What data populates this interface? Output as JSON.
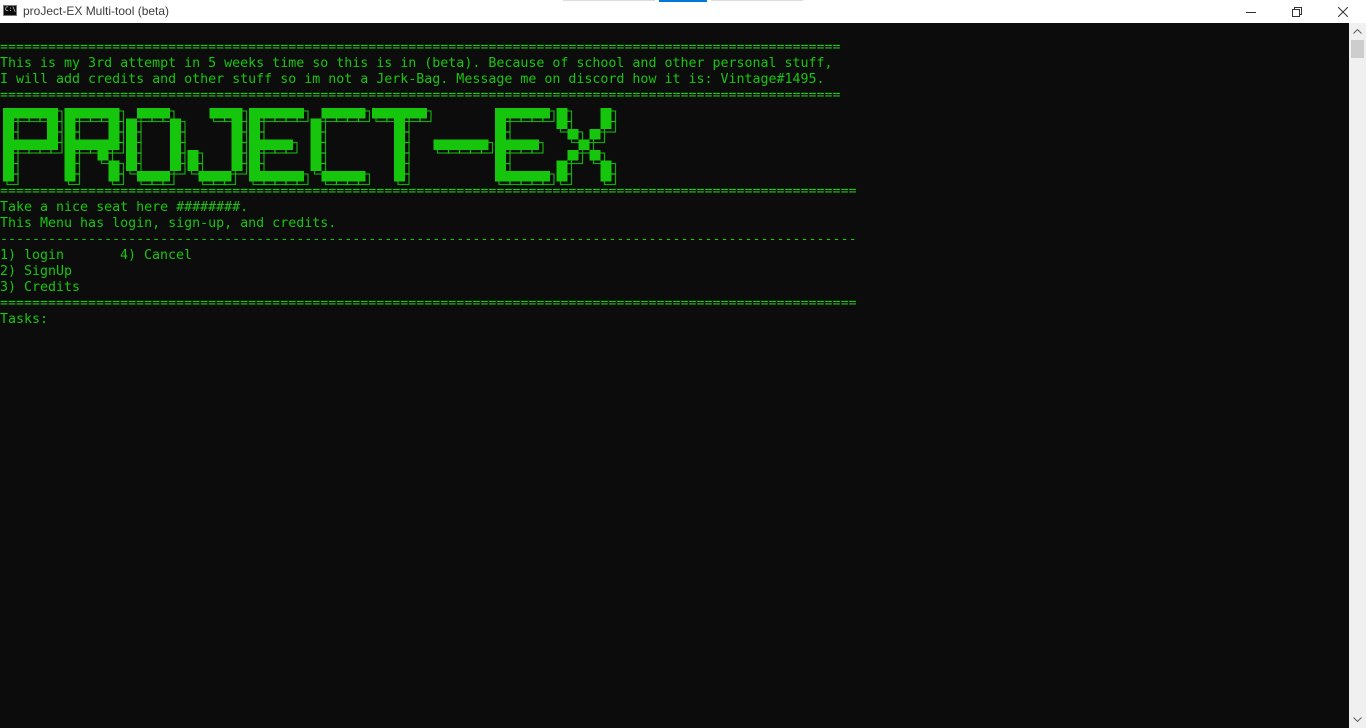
{
  "window": {
    "title": "proJect-EX Multi-tool (beta)",
    "icon": "console-icon"
  },
  "caption_buttons": {
    "minimize": "minimize-icon",
    "maximize": "restore-icon",
    "close": "close-icon"
  },
  "console": {
    "separator_eq": "=============================================================================================================================================",
    "separator_dash": "---------------------------------------------------------------------------------------------------------------------------------------------",
    "intro_line_1": "This is my 3rd attempt in 5 weeks time so this is in (beta). Because of school and other personal stuff,",
    "intro_line_2": "I will add credits and other stuff so im not a Jerk-Bag. Message me on discord how it is: Vintage#1495.",
    "banner_text": "PROJECT-EX",
    "welcome_line": "Take a nice seat here ########.",
    "menu_description": "This Menu has login, sign-up, and credits.",
    "menu_options": [
      "1) login",
      "2) SignUp",
      "3) Credits",
      "4) Cancel"
    ],
    "prompt": "Tasks:",
    "text_color": "#16c60c",
    "background_color": "#0c0c0c"
  }
}
